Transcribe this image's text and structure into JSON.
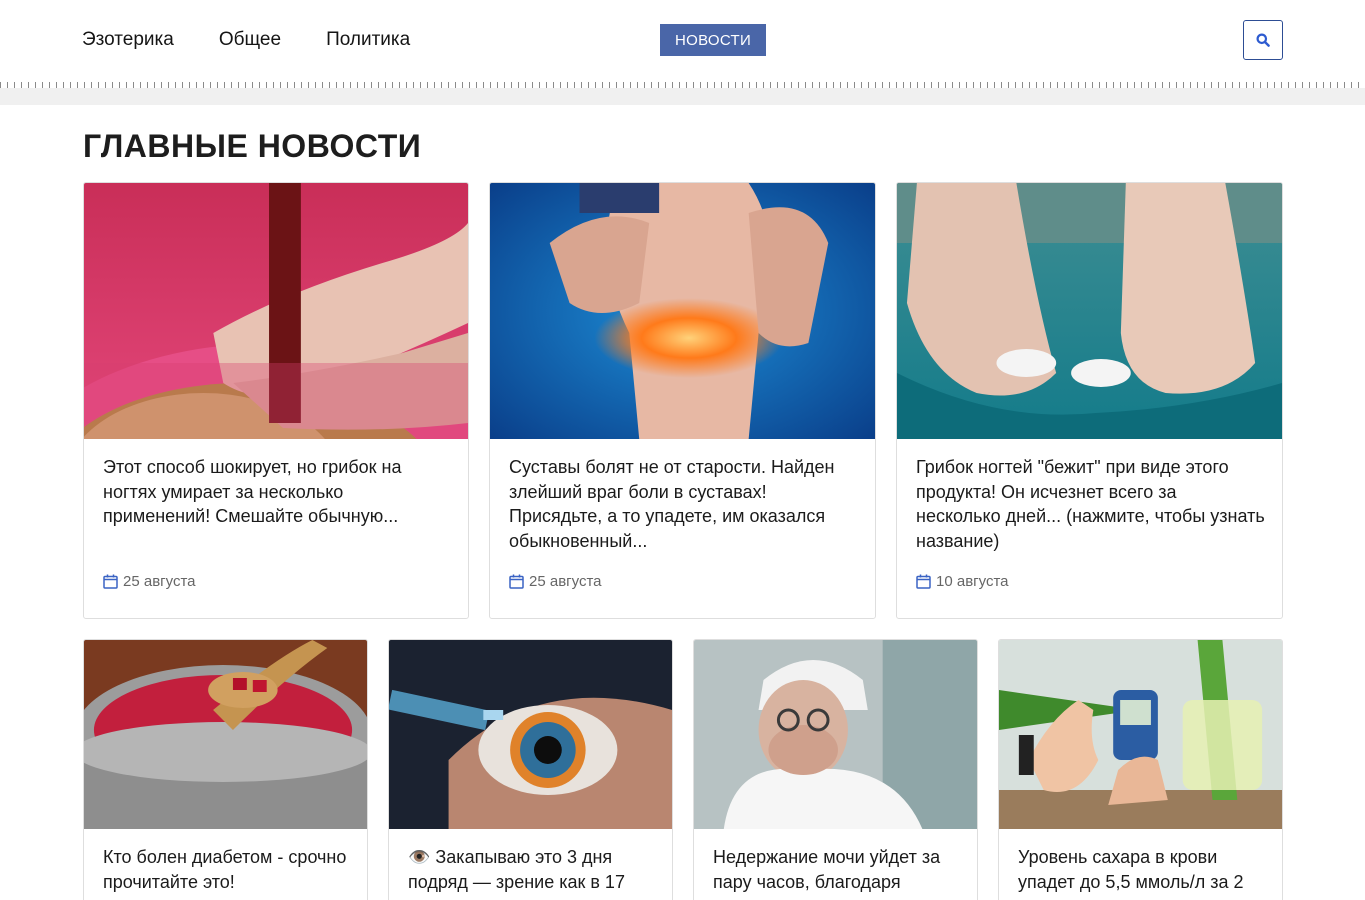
{
  "nav": {
    "items": [
      "Эзотерика",
      "Общее",
      "Политика"
    ],
    "badge": "НОВОСТИ",
    "search_icon": "search-icon"
  },
  "section": {
    "title": "ГЛАВНЫЕ НОВОСТИ"
  },
  "colors": {
    "accent": "#4a66a8",
    "search_border": "#2d4d94",
    "date_icon": "#3a63c4"
  },
  "cards_top": [
    {
      "title": "Этот способ шокирует, но грибок на ногтях умирает за несколько применений! Смешайте обычную...",
      "date": "25 августа",
      "image": "foot-bath-photo"
    },
    {
      "title": "Суставы болят не от старости. Найден злейший враг боли в суставах! Присядьте, а то упадете, им оказался обыкновенный...",
      "date": "25 августа",
      "image": "knee-pain-photo"
    },
    {
      "title": "Грибок ногтей \"бежит\" при виде этого продукта! Он исчезнет всего за несколько дней... (нажмите, чтобы узнать название)",
      "date": "10 августа",
      "image": "feet-spoon-photo"
    }
  ],
  "cards_bottom": [
    {
      "title": "Кто болен диабетом - срочно прочитайте это!",
      "image": "beet-pot-photo"
    },
    {
      "title": "👁️ Закапываю это 3 дня подряд — зрение как в 17",
      "image": "eye-drops-photo"
    },
    {
      "title": "Недержание мочи уйдет за пару часов, благодаря",
      "image": "old-doctor-photo"
    },
    {
      "title": "Уровень сахара в крови упадет до 5,5 ммоль/л за 2",
      "image": "glucose-meter-photo"
    }
  ]
}
